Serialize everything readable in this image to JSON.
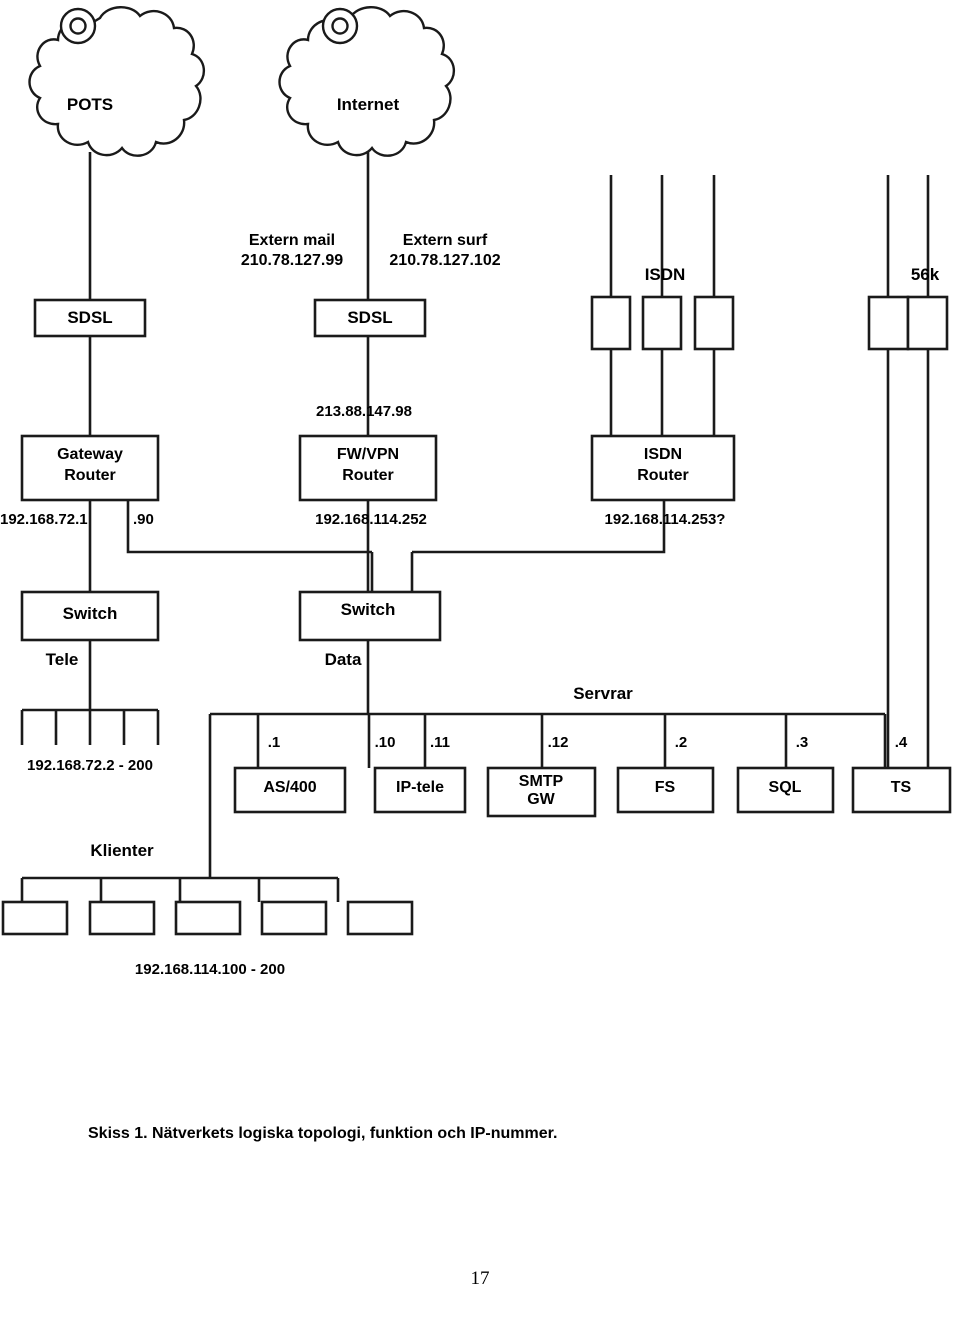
{
  "page": {
    "number": "17",
    "caption": "Skiss 1. Nätverkets logiska topologi, funktion och IP-nummer."
  },
  "clouds": [
    {
      "name": "POTS",
      "label": "POTS",
      "icon": "cloud-icon"
    },
    {
      "name": "Internet",
      "label": "Internet",
      "icon": "cloud-icon"
    }
  ],
  "wan_links": {
    "extern_mail_label": "Extern mail",
    "extern_mail_ip": "210.78.127.99",
    "extern_surf_label": "Extern surf",
    "extern_surf_ip": "210.78.127.102"
  },
  "modems": {
    "sdsl_pots": "SDSL",
    "sdsl_internet": "SDSL",
    "isdn_label": "ISDN",
    "modem56k_label": "56k",
    "isdn_count": 3,
    "modem56k_count": 2
  },
  "routers": [
    {
      "name": "gateway-router",
      "line1": "Gateway",
      "line2": "Router",
      "ip_left": "192.168.72.1",
      "ip_right": ".90"
    },
    {
      "name": "fwvpn-router",
      "line1": "FW/VPN",
      "line2": "Router",
      "ip_above": "213.88.147.98",
      "ip_below": "192.168.114.252"
    },
    {
      "name": "isdn-router",
      "line1": "ISDN",
      "line2": "Router",
      "ip_below": "192.168.114.253?"
    }
  ],
  "switches": [
    {
      "name": "switch-tele",
      "label": "Switch",
      "sublabel": "Tele",
      "range": "192.168.72.2 - 200",
      "ports": 5
    },
    {
      "name": "switch-data",
      "label": "Switch",
      "sublabel": "Data"
    }
  ],
  "servers_group_label": "Servrar",
  "servers": [
    {
      "name": "as400",
      "label": "AS/400",
      "ip": ".1"
    },
    {
      "name": "ip-tele",
      "label": "IP-tele",
      "ip": ".10",
      "ip2": ".11"
    },
    {
      "name": "smtp-gw",
      "label": "SMTP\nGW",
      "ip": ".12"
    },
    {
      "name": "fs",
      "label": "FS",
      "ip": ".2"
    },
    {
      "name": "sql",
      "label": "SQL",
      "ip": ".3"
    },
    {
      "name": "ts",
      "label": "TS",
      "ip": ".4"
    }
  ],
  "clients": {
    "label": "Klienter",
    "range": "192.168.114.100 - 200",
    "count": 5
  },
  "colors": {
    "stroke": "#1a1a1a",
    "text": "#000000",
    "background": "#ffffff"
  }
}
